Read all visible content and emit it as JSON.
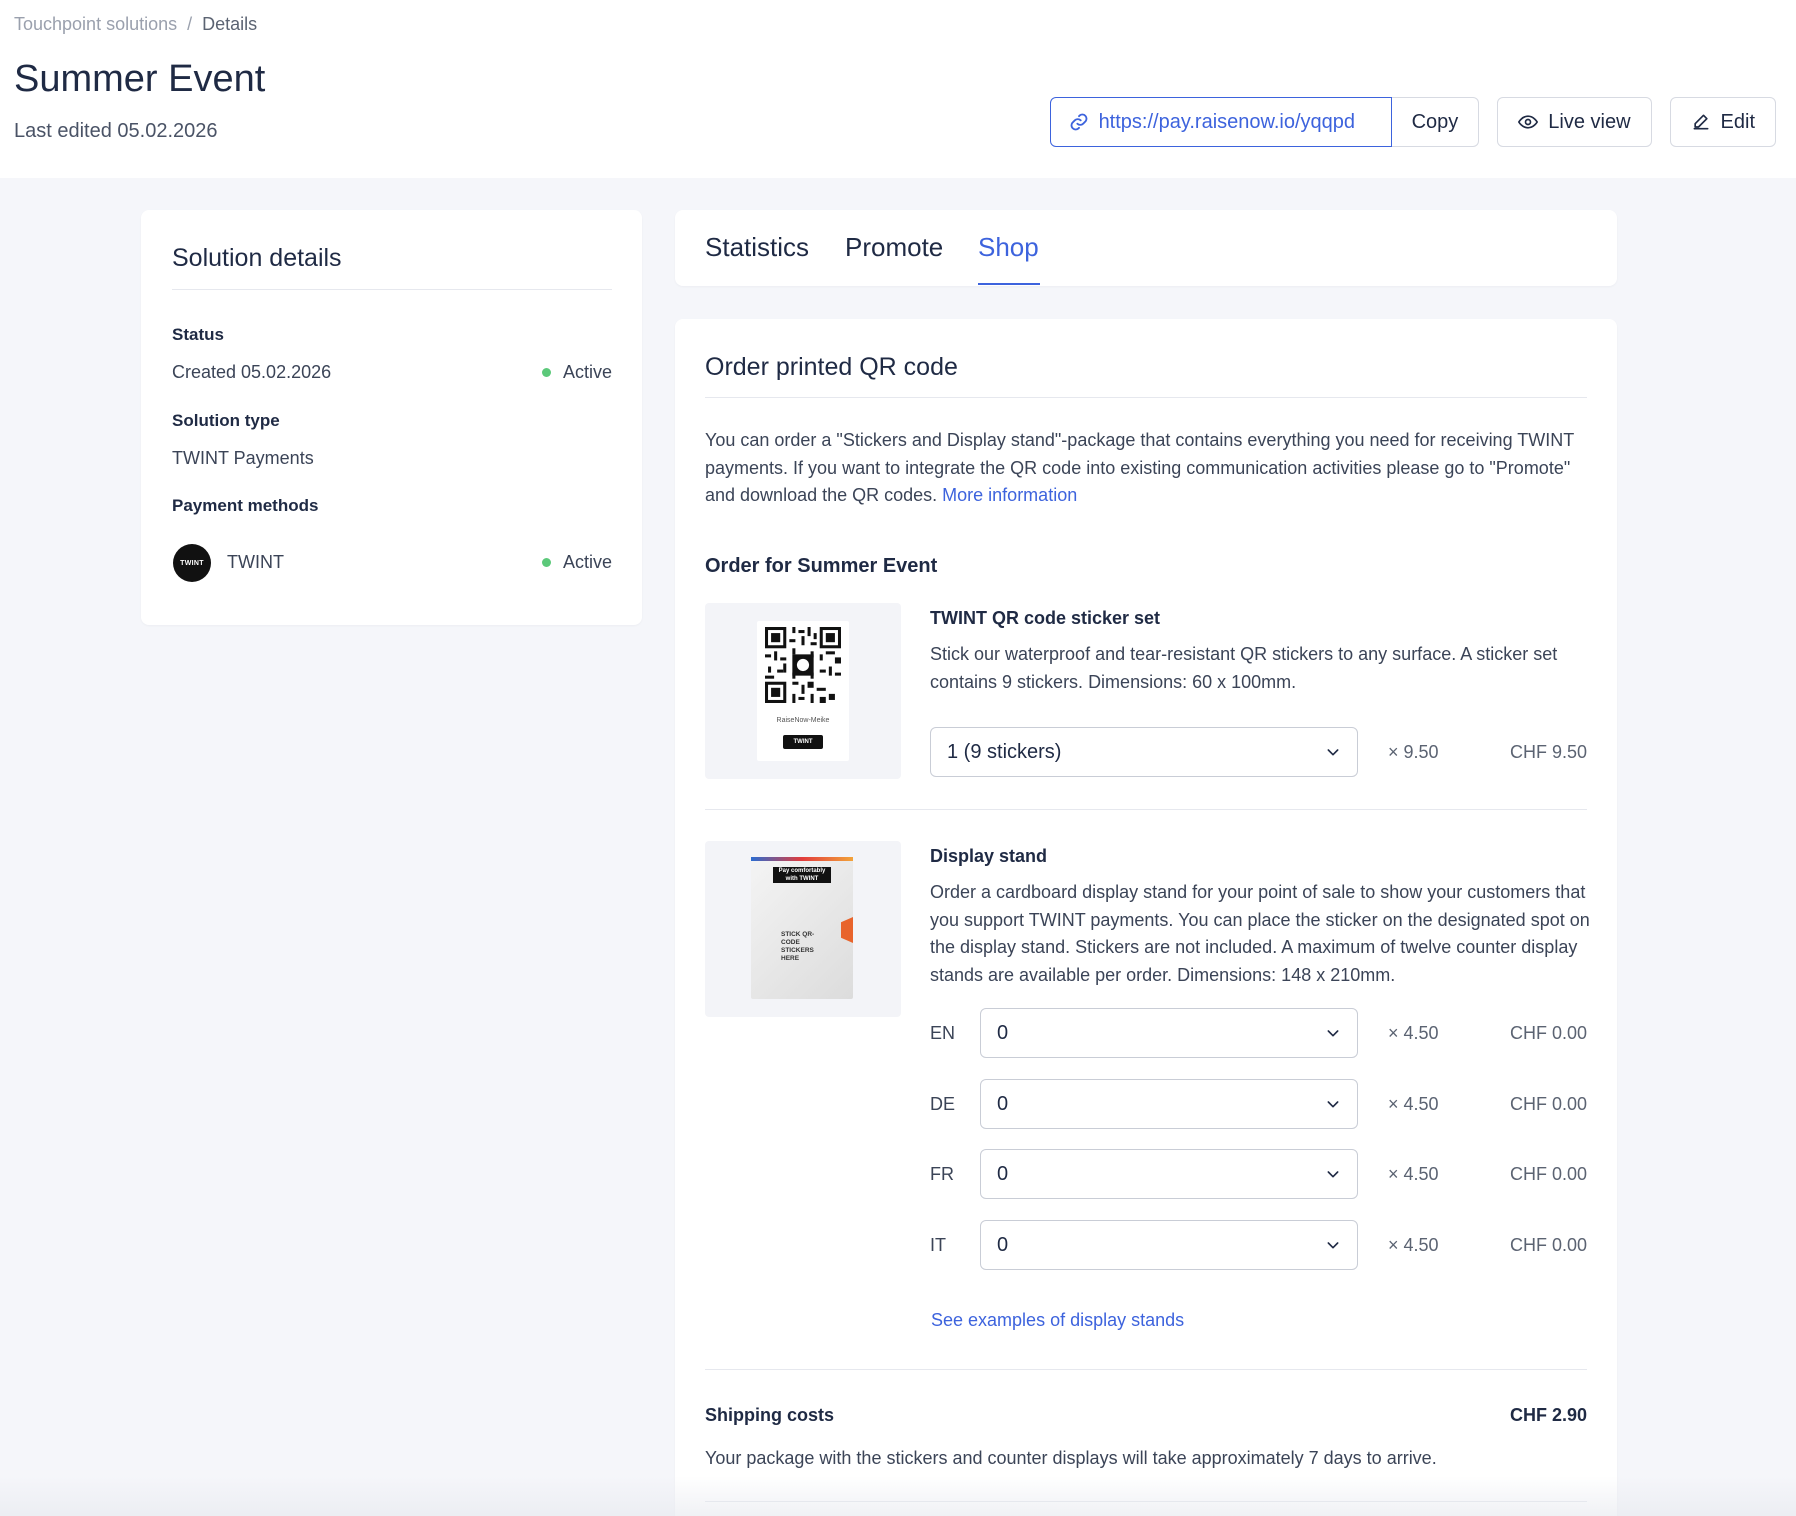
{
  "breadcrumb": {
    "root": "Touchpoint solutions",
    "separator": "/",
    "current": "Details"
  },
  "header": {
    "title": "Summer Event",
    "subtitle": "Last edited 05.02.2026",
    "url": "https://pay.raisenow.io/yqqpd",
    "copy_label": "Copy",
    "live_view_label": "Live view",
    "edit_label": "Edit"
  },
  "solution_details": {
    "title": "Solution details",
    "status_label": "Status",
    "created": "Created 05.02.2026",
    "status": "Active",
    "type_label": "Solution type",
    "type": "TWINT Payments",
    "payment_methods_label": "Payment methods",
    "payment_method": "TWINT",
    "payment_method_logo": "TWINT",
    "payment_status": "Active"
  },
  "tabs": [
    {
      "label": "Statistics"
    },
    {
      "label": "Promote"
    },
    {
      "label": "Shop",
      "active": true
    }
  ],
  "shop": {
    "title": "Order printed QR code",
    "intro": "You can order a \"Stickers and Display stand\"-package that contains everything you need for receiving TWINT payments. If you want to integrate the QR code into existing communication activities please go to \"Promote\" and download the QR codes. ",
    "more_info": "More information",
    "order_title": "Order for Summer Event",
    "sticker": {
      "title": "TWINT QR code sticker set",
      "desc": "Stick our waterproof and tear-resistant QR stickers to any surface. A sticker set contains 9 stickers. Dimensions: 60 x 100mm.",
      "select_value": "1 (9 stickers)",
      "multiplier": "× 9.50",
      "price": "CHF 9.50",
      "img_caption": "RaiseNow-Meike",
      "img_logo": "TWINT"
    },
    "display": {
      "title": "Display stand",
      "desc": "Order a cardboard display stand for your point of sale to show your customers that you support TWINT payments. You can place the sticker on the designated spot on the display stand. Stickers are not included. A maximum of twelve counter display stands are available per order. Dimensions: 148 x 210mm.",
      "img_head": "Pay comfortably with TWINT",
      "img_text": "STICK QR-CODE STICKERS HERE",
      "rows": [
        {
          "lang": "EN",
          "value": "0",
          "multiplier": "× 4.50",
          "price": "CHF 0.00"
        },
        {
          "lang": "DE",
          "value": "0",
          "multiplier": "× 4.50",
          "price": "CHF 0.00"
        },
        {
          "lang": "FR",
          "value": "0",
          "multiplier": "× 4.50",
          "price": "CHF 0.00"
        },
        {
          "lang": "IT",
          "value": "0",
          "multiplier": "× 4.50",
          "price": "CHF 0.00"
        }
      ],
      "examples_link": "See examples of display stands"
    },
    "shipping": {
      "title": "Shipping costs",
      "price": "CHF 2.90",
      "desc": "Your package with the stickers and counter displays will take approximately 7 days to arrive."
    }
  },
  "colors": {
    "accent": "#3d63dd",
    "active_dot": "#5cc97a",
    "background": "#f5f6fa"
  }
}
